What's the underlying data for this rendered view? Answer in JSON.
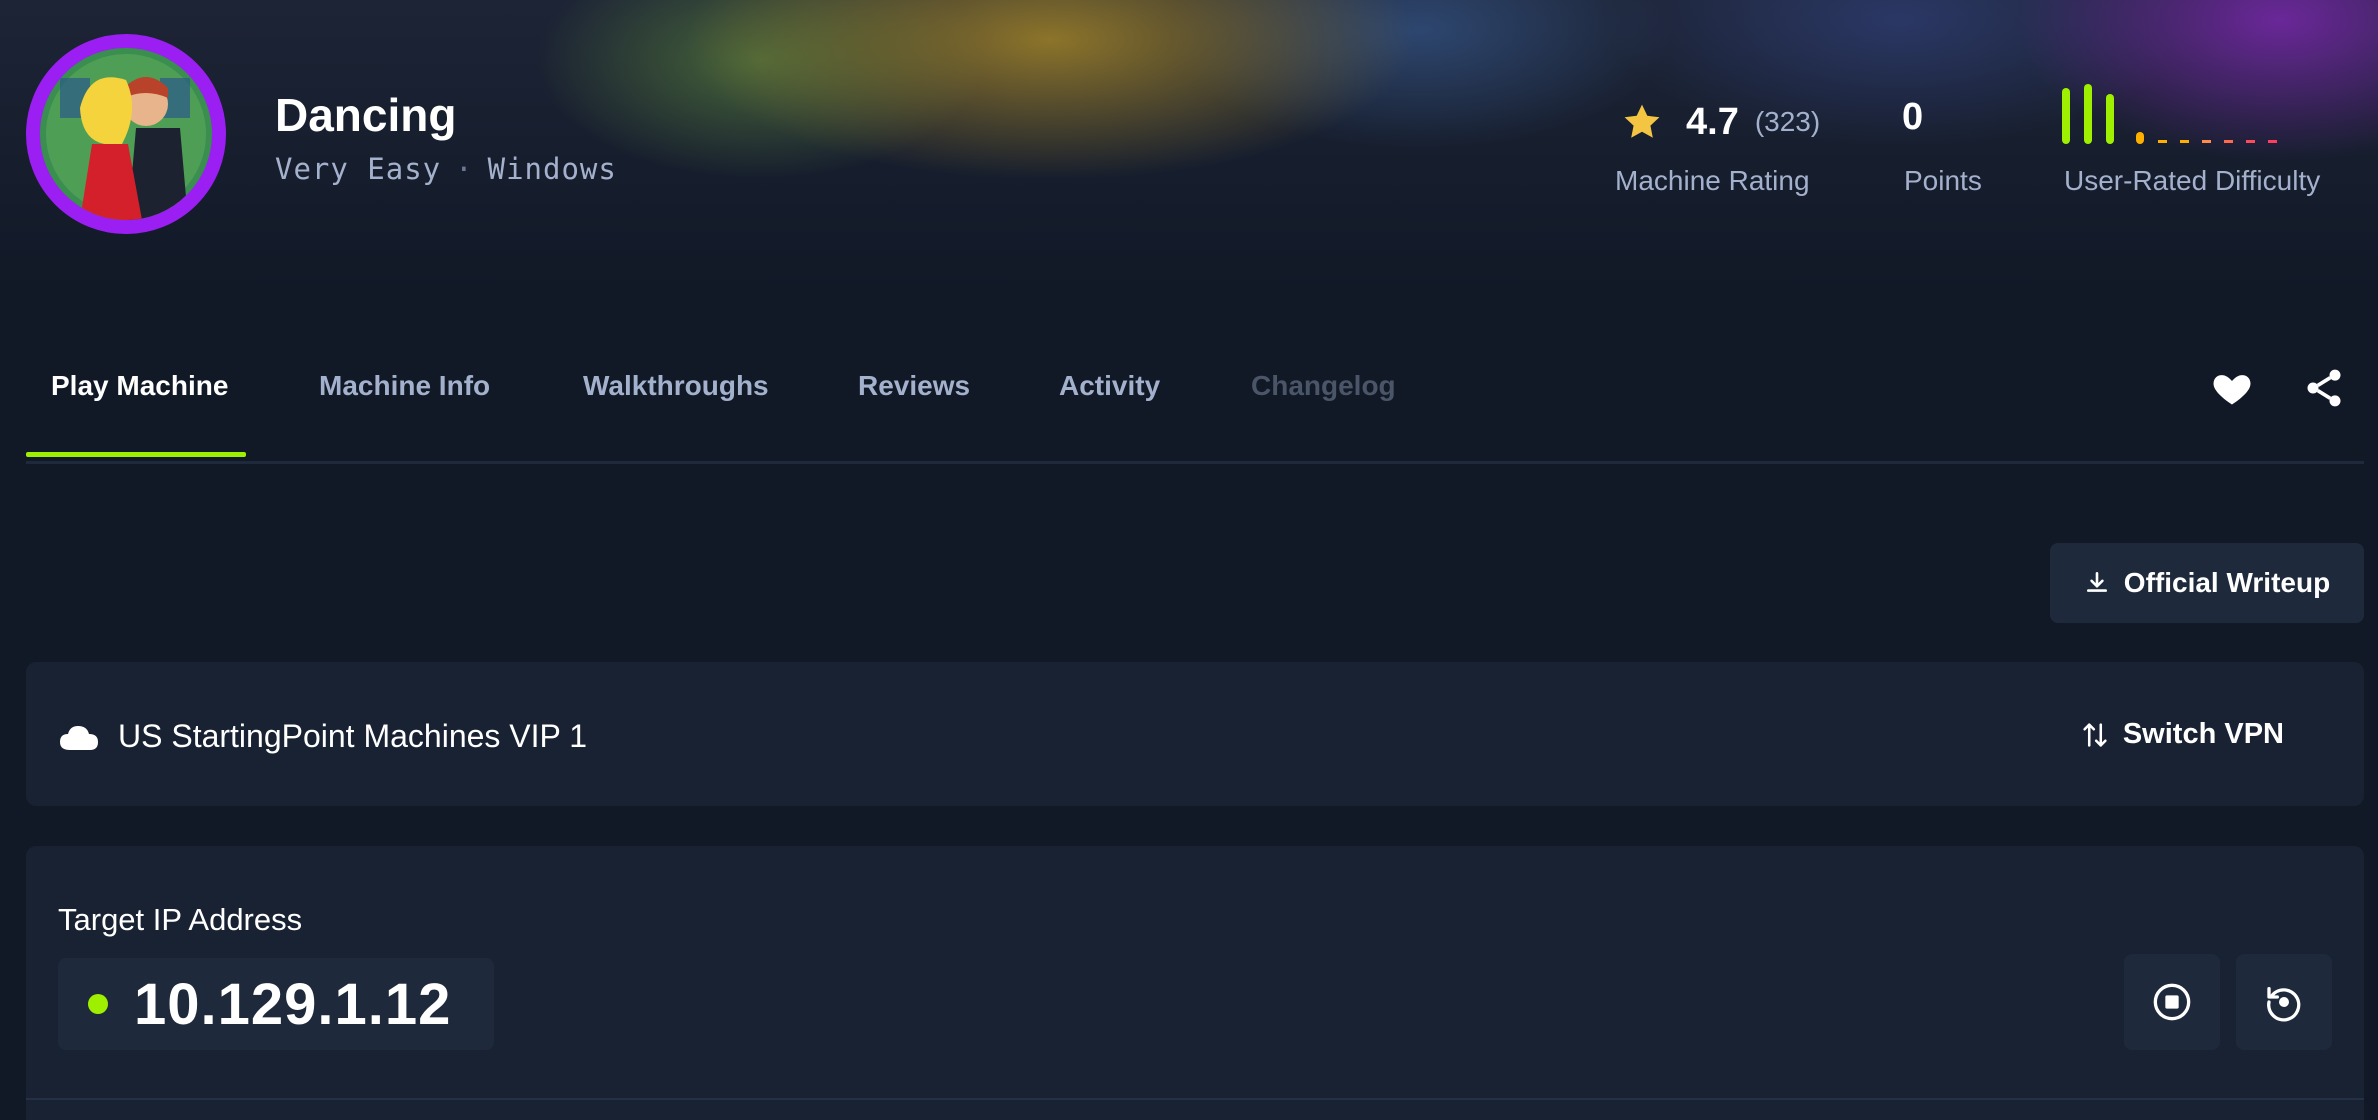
{
  "machine": {
    "name": "Dancing",
    "difficulty": "Very Easy",
    "separator": "·",
    "os": "Windows"
  },
  "stats": {
    "rating_value": "4.7",
    "rating_count": "(323)",
    "rating_label": "Machine Rating",
    "points_value": "0",
    "points_label": "Points",
    "difficulty_label": "User-Rated Difficulty"
  },
  "tabs": [
    {
      "label": "Play Machine",
      "active": true
    },
    {
      "label": "Machine Info"
    },
    {
      "label": "Walkthroughs"
    },
    {
      "label": "Reviews"
    },
    {
      "label": "Activity"
    },
    {
      "label": "Changelog",
      "disabled": true
    }
  ],
  "actions": {
    "writeup_label": "Official Writeup",
    "favorite_icon": "heart-icon",
    "share_icon": "share-icon"
  },
  "vpn": {
    "server": "US StartingPoint Machines VIP 1",
    "switch_label": "Switch VPN"
  },
  "target": {
    "label": "Target IP Address",
    "ip": "10.129.1.12",
    "status": "online"
  },
  "colors": {
    "accent": "#9fef00",
    "avatar_ring": "#9b1ff2",
    "star": "#f4c542",
    "background": "#111927",
    "panel": "#182233"
  }
}
